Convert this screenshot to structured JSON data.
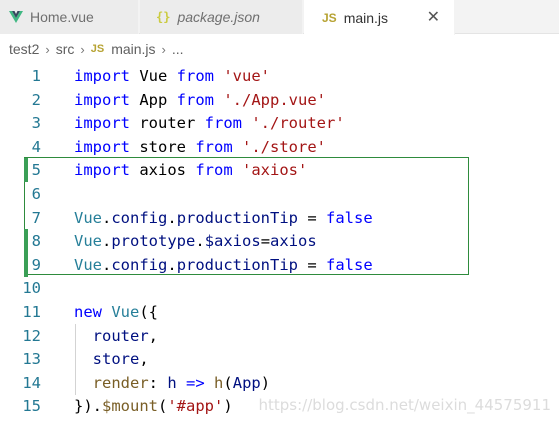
{
  "tabs": [
    {
      "label": "Home.vue",
      "icon": "vue-icon",
      "italic": false,
      "active": false
    },
    {
      "label": "package.json",
      "icon": "json-icon",
      "italic": true,
      "active": false
    },
    {
      "label": "main.js",
      "icon": "js-icon",
      "italic": false,
      "active": true,
      "close": "✕"
    }
  ],
  "icons": {
    "json": "{}",
    "js": "JS"
  },
  "breadcrumb": {
    "items": [
      "test2",
      "src",
      "main.js",
      "..."
    ],
    "separator": "›"
  },
  "editor": {
    "lines": [
      {
        "n": "1",
        "tokens": [
          [
            "kw",
            "import"
          ],
          [
            "pl",
            " Vue "
          ],
          [
            "kw",
            "from"
          ],
          [
            "pl",
            " "
          ],
          [
            "str",
            "'vue'"
          ]
        ]
      },
      {
        "n": "2",
        "tokens": [
          [
            "kw",
            "import"
          ],
          [
            "pl",
            " App "
          ],
          [
            "kw",
            "from"
          ],
          [
            "pl",
            " "
          ],
          [
            "str",
            "'./App.vue'"
          ]
        ]
      },
      {
        "n": "3",
        "tokens": [
          [
            "kw",
            "import"
          ],
          [
            "pl",
            " router "
          ],
          [
            "kw",
            "from"
          ],
          [
            "pl",
            " "
          ],
          [
            "str",
            "'./router'"
          ]
        ]
      },
      {
        "n": "4",
        "tokens": [
          [
            "kw",
            "import"
          ],
          [
            "pl",
            " store "
          ],
          [
            "kw",
            "from"
          ],
          [
            "pl",
            " "
          ],
          [
            "str",
            "'./store'"
          ]
        ]
      },
      {
        "n": "5",
        "tokens": [
          [
            "kw",
            "import"
          ],
          [
            "pl",
            " axios "
          ],
          [
            "kw",
            "from"
          ],
          [
            "pl",
            " "
          ],
          [
            "str",
            "'axios'"
          ]
        ],
        "modified": true
      },
      {
        "n": "6",
        "tokens": []
      },
      {
        "n": "7",
        "tokens": [
          [
            "cls",
            "Vue"
          ],
          [
            "pl",
            "."
          ],
          [
            "id",
            "config"
          ],
          [
            "pl",
            "."
          ],
          [
            "id",
            "productionTip"
          ],
          [
            "pl",
            " = "
          ],
          [
            "kw",
            "false"
          ]
        ]
      },
      {
        "n": "8",
        "tokens": [
          [
            "cls",
            "Vue"
          ],
          [
            "pl",
            "."
          ],
          [
            "id",
            "prototype"
          ],
          [
            "pl",
            "."
          ],
          [
            "id",
            "$axios"
          ],
          [
            "pl",
            "="
          ],
          [
            "id",
            "axios"
          ]
        ],
        "modified": true
      },
      {
        "n": "9",
        "tokens": [
          [
            "cls",
            "Vue"
          ],
          [
            "pl",
            "."
          ],
          [
            "id",
            "config"
          ],
          [
            "pl",
            "."
          ],
          [
            "id",
            "productionTip"
          ],
          [
            "pl",
            " = "
          ],
          [
            "kw",
            "false"
          ]
        ],
        "modified": true
      },
      {
        "n": "10",
        "tokens": []
      },
      {
        "n": "11",
        "tokens": [
          [
            "kw",
            "new"
          ],
          [
            "pl",
            " "
          ],
          [
            "cls",
            "Vue"
          ],
          [
            "pl",
            "({"
          ]
        ]
      },
      {
        "n": "12",
        "tokens": [
          [
            "pl",
            "  "
          ],
          [
            "id",
            "router"
          ],
          [
            "pl",
            ","
          ]
        ],
        "guide": true
      },
      {
        "n": "13",
        "tokens": [
          [
            "pl",
            "  "
          ],
          [
            "id",
            "store"
          ],
          [
            "pl",
            ","
          ]
        ],
        "guide": true
      },
      {
        "n": "14",
        "tokens": [
          [
            "pl",
            "  "
          ],
          [
            "fn",
            "render"
          ],
          [
            "pl",
            ": "
          ],
          [
            "id",
            "h"
          ],
          [
            "pl",
            " "
          ],
          [
            "kw",
            "=>"
          ],
          [
            "pl",
            " "
          ],
          [
            "fn",
            "h"
          ],
          [
            "pl",
            "("
          ],
          [
            "id",
            "App"
          ],
          [
            "pl",
            ")"
          ]
        ],
        "guide": true
      },
      {
        "n": "15",
        "tokens": [
          [
            "pl",
            "})."
          ],
          [
            "fn",
            "$mount"
          ],
          [
            "pl",
            "("
          ],
          [
            "str",
            "'#app'"
          ],
          [
            "pl",
            ")"
          ]
        ]
      }
    ]
  },
  "watermark": "https://blog.csdn.net/weixin_44575911"
}
